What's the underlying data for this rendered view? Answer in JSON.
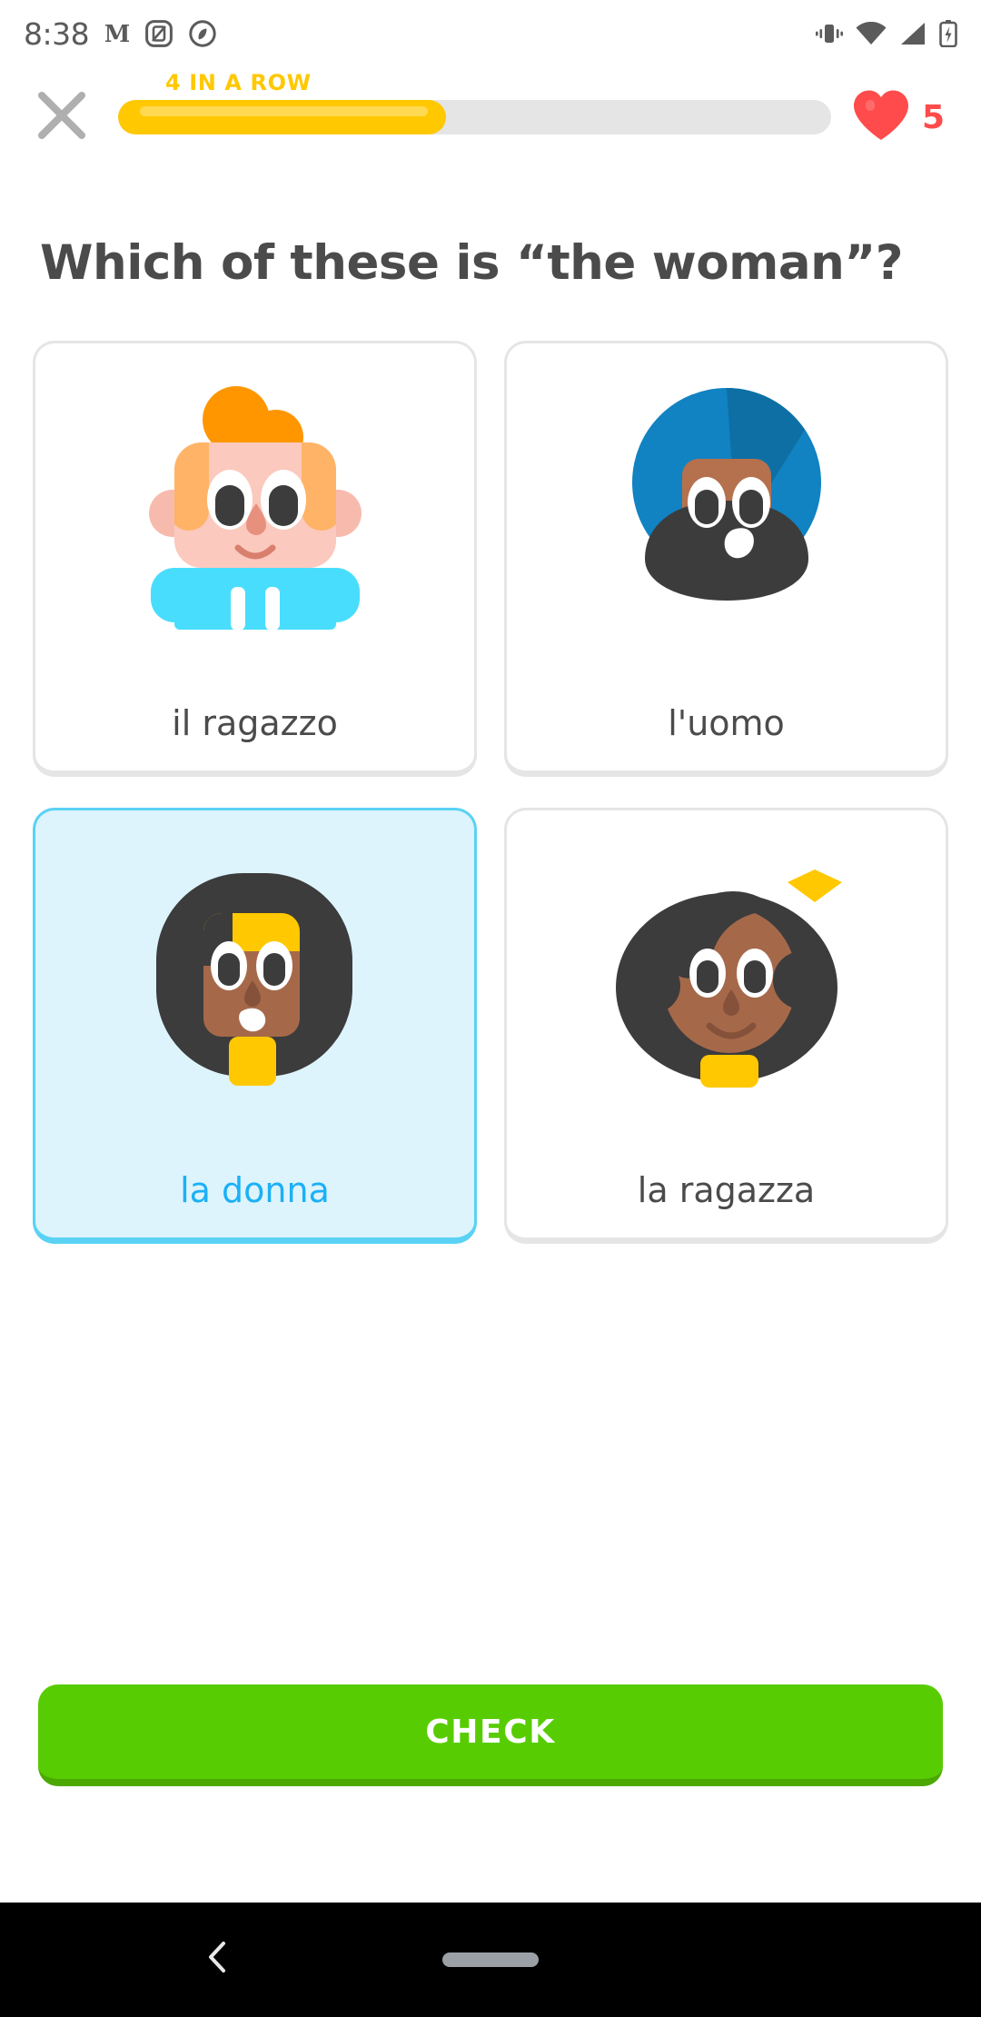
{
  "status_bar": {
    "clock": "8:38",
    "icons_left": [
      "m-badge-icon",
      "screenshot-icon",
      "sync-circle-icon"
    ],
    "icons_right": [
      "vibrate-icon",
      "wifi-icon",
      "cellular-signal-icon",
      "battery-charging-icon"
    ]
  },
  "header": {
    "close_icon": "close-x-icon",
    "streak_label": "4 IN A ROW",
    "progress_percent": 46,
    "progress_fill_color": "#FFC800",
    "progress_track_color": "#E5E5E5",
    "heart_icon": "heart-icon",
    "heart_count": "5",
    "heart_color": "#FF4B4B"
  },
  "question": {
    "prompt": "Which of these is “the woman”?"
  },
  "choices": [
    {
      "label": "il ragazzo",
      "art": "boy-orange-hair-avatar",
      "selected": false
    },
    {
      "label": "l'uomo",
      "art": "man-blue-turban-beard-avatar",
      "selected": false
    },
    {
      "label": "la donna",
      "art": "woman-dark-hair-avatar",
      "selected": true
    },
    {
      "label": "la ragazza",
      "art": "girl-yellow-bow-avatar",
      "selected": false
    }
  ],
  "footer": {
    "check_label": "CHECK",
    "check_color": "#58CC02"
  },
  "nav_bar": {
    "back_icon": "back-chevron-icon",
    "home_indicator": "home-pill-icon"
  },
  "colors": {
    "selected_bg": "#DDF4FD",
    "selected_border": "#5AD2F4",
    "selected_text": "#1CB0F6",
    "card_border": "#E5E5E5",
    "text": "#4B4B4B",
    "streak": "#FFC800"
  }
}
